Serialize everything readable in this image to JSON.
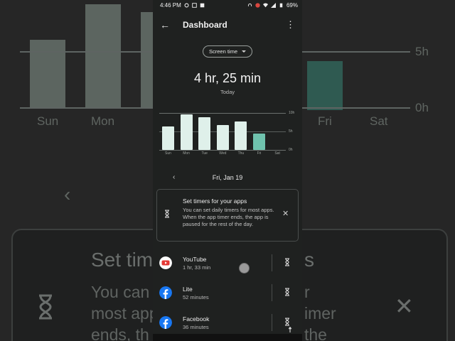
{
  "status_bar": {
    "time": "4:46 PM",
    "battery": "69%"
  },
  "app_bar": {
    "title": "Dashboard",
    "back_icon": "arrow-left-icon",
    "menu_icon": "more-vert-icon"
  },
  "selector": {
    "label": "Screen time"
  },
  "summary": {
    "total": "4 hr, 25 min",
    "period": "Today"
  },
  "chart_data": {
    "type": "bar",
    "categories": [
      "Sun",
      "Mon",
      "Tue",
      "Wed",
      "Thu",
      "Fri",
      "Sat"
    ],
    "values": [
      6.3,
      9.6,
      8.9,
      6.7,
      7.7,
      4.4,
      0
    ],
    "units": "h",
    "highlighted_category": "Fri",
    "y_ticks": [
      "10h",
      "5h",
      "0h"
    ],
    "ylim": [
      0,
      10
    ],
    "colors": {
      "bar": "#dff0ea",
      "today": "#6fc2ad"
    }
  },
  "date_nav": {
    "date": "Fri, Jan 19",
    "prev_icon": "chevron-left-icon"
  },
  "timer_card": {
    "title": "Set timers for your apps",
    "text": "You can set daily timers for most apps. When the app timer ends, the app is paused for the rest of the day.",
    "icon": "hourglass-icon",
    "close_icon": "close-icon"
  },
  "apps": [
    {
      "name": "YouTube",
      "time": "1 hr, 33 min",
      "icon": "youtube-icon"
    },
    {
      "name": "Lite",
      "time": "52 minutes",
      "icon": "facebook-lite-icon"
    },
    {
      "name": "Facebook",
      "time": "36 minutes",
      "icon": "facebook-icon"
    }
  ],
  "background_copy": {
    "labels": [
      "Sun",
      "Mon",
      "Fri",
      "Sat"
    ],
    "ticks": [
      "5h",
      "0h"
    ],
    "title_fragment": "Set tim",
    "title_fragment_right": "s",
    "text_lines": [
      "You can",
      "most app",
      "ends, th"
    ],
    "text_right": [
      "r",
      "imer",
      "the"
    ]
  }
}
